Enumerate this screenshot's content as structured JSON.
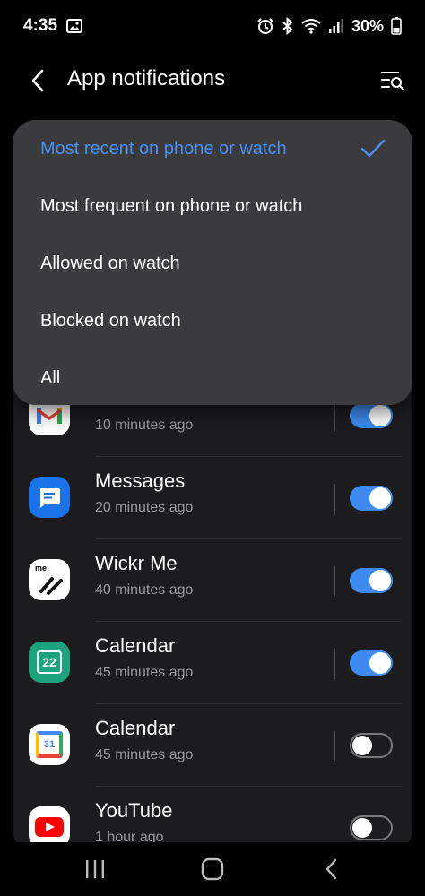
{
  "status_bar": {
    "time": "4:35",
    "battery": "30%",
    "icons": [
      "gallery-icon",
      "alarm-icon",
      "bluetooth-icon",
      "wifi-icon",
      "signal-icon",
      "battery-icon"
    ]
  },
  "header": {
    "title": "App notifications",
    "back_icon": "back-arrow-icon",
    "filter_icon": "filter-search-icon"
  },
  "dropdown": {
    "selected_index": 0,
    "accent_color": "#4a90f3",
    "options": [
      "Most recent on phone or watch",
      "Most frequent on phone or watch",
      "Allowed on watch",
      "Blocked on watch",
      "All"
    ]
  },
  "apps": [
    {
      "name": "Gmail",
      "time": "10 minutes ago",
      "enabled": true,
      "icon": "gmail-icon"
    },
    {
      "name": "Messages",
      "time": "20 minutes ago",
      "enabled": true,
      "icon": "messages-icon"
    },
    {
      "name": "Wickr Me",
      "time": "40 minutes ago",
      "enabled": true,
      "icon": "wickr-icon",
      "icon_text": "me"
    },
    {
      "name": "Calendar",
      "time": "45 minutes ago",
      "enabled": true,
      "icon": "samsung-calendar-icon",
      "icon_text": "22"
    },
    {
      "name": "Calendar",
      "time": "45 minutes ago",
      "enabled": false,
      "icon": "google-calendar-icon",
      "icon_text": "31"
    },
    {
      "name": "YouTube",
      "time": "1 hour ago",
      "enabled": false,
      "icon": "youtube-icon"
    }
  ],
  "colors": {
    "toggle_on": "#3e8bf0",
    "card_bg": "#1c1c1e",
    "dropdown_bg": "#3b3b3d"
  },
  "nav_bar": {
    "icons": [
      "recents-icon",
      "home-icon",
      "back-icon"
    ]
  }
}
